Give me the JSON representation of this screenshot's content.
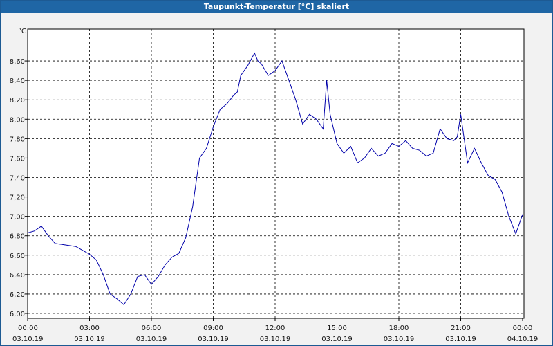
{
  "window": {
    "title": "Taupunkt-Temperatur [°C] skaliert"
  },
  "colors": {
    "line": "#0000aa",
    "grid": "#000000",
    "titlebar": "#1f66a5"
  },
  "chart_data": {
    "type": "line",
    "title": "Taupunkt-Temperatur [°C] skaliert",
    "ylabel": "°C",
    "xlabel": "",
    "ylim": [
      6.0,
      8.8
    ],
    "xlim": [
      "03.10.19 00:00",
      "04.10.19 00:00"
    ],
    "grid": true,
    "y_ticks": [
      "6,00",
      "6,20",
      "6,40",
      "6,60",
      "6,80",
      "7,00",
      "7,20",
      "7,40",
      "7,60",
      "7,80",
      "8,00",
      "8,20",
      "8,40",
      "8,60"
    ],
    "x_ticks": [
      {
        "time": "00:00",
        "date": "03.10.19"
      },
      {
        "time": "03:00",
        "date": "03.10.19"
      },
      {
        "time": "06:00",
        "date": "03.10.19"
      },
      {
        "time": "09:00",
        "date": "03.10.19"
      },
      {
        "time": "12:00",
        "date": "03.10.19"
      },
      {
        "time": "15:00",
        "date": "03.10.19"
      },
      {
        "time": "18:00",
        "date": "03.10.19"
      },
      {
        "time": "21:00",
        "date": "03.10.19"
      },
      {
        "time": "00:00",
        "date": "04.10.19"
      }
    ],
    "series": [
      {
        "x": [
          "03.10.19 00:00",
          "03.10.19 00:20",
          "03.10.19 00:40",
          "03.10.19 01:00",
          "03.10.19 01:20",
          "03.10.19 01:40",
          "03.10.19 02:00",
          "03.10.19 02:20",
          "03.10.19 02:40",
          "03.10.19 03:00",
          "03.10.19 03:20",
          "03.10.19 03:40",
          "03.10.19 04:00",
          "03.10.19 04:20",
          "03.10.19 04:40",
          "03.10.19 05:00",
          "03.10.19 05:20",
          "03.10.19 05:40",
          "03.10.19 06:00",
          "03.10.19 06:20",
          "03.10.19 06:40",
          "03.10.19 07:00",
          "03.10.19 07:20",
          "03.10.19 07:40",
          "03.10.19 08:00",
          "03.10.19 08:20",
          "03.10.19 08:40",
          "03.10.19 09:00",
          "03.10.19 09:20",
          "03.10.19 09:40",
          "03.10.19 10:00",
          "03.10.19 10:10",
          "03.10.19 10:20",
          "03.10.19 10:40",
          "03.10.19 11:00",
          "03.10.19 11:10",
          "03.10.19 11:20",
          "03.10.19 11:40",
          "03.10.19 12:00",
          "03.10.19 12:20",
          "03.10.19 12:40",
          "03.10.19 13:00",
          "03.10.19 13:20",
          "03.10.19 13:40",
          "03.10.19 14:00",
          "03.10.19 14:20",
          "03.10.19 14:30",
          "03.10.19 14:40",
          "03.10.19 15:00",
          "03.10.19 15:20",
          "03.10.19 15:40",
          "03.10.19 16:00",
          "03.10.19 16:20",
          "03.10.19 16:40",
          "03.10.19 17:00",
          "03.10.19 17:20",
          "03.10.19 17:40",
          "03.10.19 18:00",
          "03.10.19 18:20",
          "03.10.19 18:40",
          "03.10.19 19:00",
          "03.10.19 19:20",
          "03.10.19 19:40",
          "03.10.19 20:00",
          "03.10.19 20:20",
          "03.10.19 20:40",
          "03.10.19 20:50",
          "03.10.19 21:00",
          "03.10.19 21:20",
          "03.10.19 21:40",
          "03.10.19 22:00",
          "03.10.19 22:20",
          "03.10.19 22:40",
          "03.10.19 23:00",
          "03.10.19 23:20",
          "03.10.19 23:40",
          "04.10.19 00:00"
        ],
        "y": [
          6.83,
          6.85,
          6.9,
          6.8,
          6.72,
          6.71,
          6.7,
          6.69,
          6.65,
          6.61,
          6.55,
          6.4,
          6.2,
          6.15,
          6.09,
          6.2,
          6.38,
          6.4,
          6.3,
          6.38,
          6.5,
          6.58,
          6.62,
          6.78,
          7.1,
          7.6,
          7.7,
          7.92,
          8.1,
          8.16,
          8.25,
          8.28,
          8.45,
          8.55,
          8.68,
          8.6,
          8.57,
          8.45,
          8.5,
          8.6,
          8.4,
          8.2,
          7.95,
          8.05,
          8.0,
          7.9,
          8.4,
          8.05,
          7.75,
          7.65,
          7.72,
          7.55,
          7.6,
          7.7,
          7.62,
          7.65,
          7.75,
          7.72,
          7.78,
          7.7,
          7.68,
          7.62,
          7.65,
          7.9,
          7.8,
          7.78,
          7.82,
          8.05,
          7.55,
          7.7,
          7.55,
          7.42,
          7.38,
          7.25,
          7.0,
          6.82,
          7.02
        ]
      }
    ]
  }
}
